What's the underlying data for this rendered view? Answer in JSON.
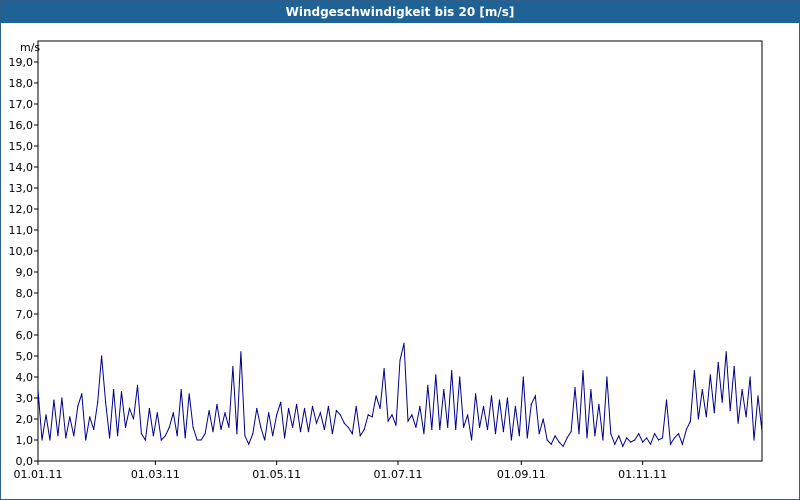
{
  "window": {
    "title": "Windgeschwindigkeit bis 20 [m/s]"
  },
  "chart_data": {
    "type": "line",
    "title": "Windgeschwindigkeit bis 20 [m/s]",
    "ylabel": "m/s",
    "xlabel": "",
    "ylim": [
      0,
      20
    ],
    "xlim": [
      "2011-01-01",
      "2011-12-31"
    ],
    "y_ticks": [
      "0,0",
      "1,0",
      "2,0",
      "3,0",
      "4,0",
      "5,0",
      "6,0",
      "7,0",
      "8,0",
      "9,0",
      "10,0",
      "11,0",
      "12,0",
      "13,0",
      "14,0",
      "15,0",
      "16,0",
      "17,0",
      "18,0",
      "19,0"
    ],
    "x_ticks": [
      {
        "label": "01.01.11",
        "date": "2011-01-01"
      },
      {
        "label": "01.03.11",
        "date": "2011-03-01"
      },
      {
        "label": "01.05.11",
        "date": "2011-05-01"
      },
      {
        "label": "01.07.11",
        "date": "2011-07-01"
      },
      {
        "label": "01.09.11",
        "date": "2011-09-01"
      },
      {
        "label": "01.11.11",
        "date": "2011-11-01"
      }
    ],
    "grid": true,
    "series_color": "#00008b",
    "series": [
      {
        "x": [
          "2011-01-01",
          "2011-01-03",
          "2011-01-05",
          "2011-01-07",
          "2011-01-09",
          "2011-01-11",
          "2011-01-13",
          "2011-01-15",
          "2011-01-17",
          "2011-01-19",
          "2011-01-21",
          "2011-01-23",
          "2011-01-25",
          "2011-01-27",
          "2011-01-29",
          "2011-01-31",
          "2011-02-02",
          "2011-02-04",
          "2011-02-06",
          "2011-02-08",
          "2011-02-10",
          "2011-02-12",
          "2011-02-14",
          "2011-02-16",
          "2011-02-18",
          "2011-02-20",
          "2011-02-22",
          "2011-02-24",
          "2011-02-26",
          "2011-02-28",
          "2011-03-02",
          "2011-03-04",
          "2011-03-06",
          "2011-03-08",
          "2011-03-10",
          "2011-03-12",
          "2011-03-14",
          "2011-03-16",
          "2011-03-18",
          "2011-03-20",
          "2011-03-22",
          "2011-03-24",
          "2011-03-26",
          "2011-03-28",
          "2011-03-30",
          "2011-04-01",
          "2011-04-03",
          "2011-04-05",
          "2011-04-07",
          "2011-04-09",
          "2011-04-11",
          "2011-04-13",
          "2011-04-15",
          "2011-04-17",
          "2011-04-19",
          "2011-04-21",
          "2011-04-23",
          "2011-04-25",
          "2011-04-27",
          "2011-04-29",
          "2011-05-01",
          "2011-05-03",
          "2011-05-05",
          "2011-05-07",
          "2011-05-09",
          "2011-05-11",
          "2011-05-13",
          "2011-05-15",
          "2011-05-17",
          "2011-05-19",
          "2011-05-21",
          "2011-05-23",
          "2011-05-25",
          "2011-05-27",
          "2011-05-29",
          "2011-05-31",
          "2011-06-02",
          "2011-06-04",
          "2011-06-06",
          "2011-06-08",
          "2011-06-10",
          "2011-06-12",
          "2011-06-14",
          "2011-06-16",
          "2011-06-18",
          "2011-06-20",
          "2011-06-22",
          "2011-06-24",
          "2011-06-26",
          "2011-06-28",
          "2011-06-30",
          "2011-07-02",
          "2011-07-04",
          "2011-07-06",
          "2011-07-08",
          "2011-07-10",
          "2011-07-12",
          "2011-07-14",
          "2011-07-16",
          "2011-07-18",
          "2011-07-20",
          "2011-07-22",
          "2011-07-24",
          "2011-07-26",
          "2011-07-28",
          "2011-07-30",
          "2011-08-01",
          "2011-08-03",
          "2011-08-05",
          "2011-08-07",
          "2011-08-09",
          "2011-08-11",
          "2011-08-13",
          "2011-08-15",
          "2011-08-17",
          "2011-08-19",
          "2011-08-21",
          "2011-08-23",
          "2011-08-25",
          "2011-08-27",
          "2011-08-29",
          "2011-08-31",
          "2011-09-02",
          "2011-09-04",
          "2011-09-06",
          "2011-09-08",
          "2011-09-10",
          "2011-09-12",
          "2011-09-14",
          "2011-09-16",
          "2011-09-18",
          "2011-09-20",
          "2011-09-22",
          "2011-09-24",
          "2011-09-26",
          "2011-09-28",
          "2011-09-30",
          "2011-10-02",
          "2011-10-04",
          "2011-10-06",
          "2011-10-08",
          "2011-10-10",
          "2011-10-12",
          "2011-10-14",
          "2011-10-16",
          "2011-10-18",
          "2011-10-20",
          "2011-10-22",
          "2011-10-24",
          "2011-10-26",
          "2011-10-28",
          "2011-10-30",
          "2011-11-01",
          "2011-11-03",
          "2011-11-05",
          "2011-11-07",
          "2011-11-09",
          "2011-11-11",
          "2011-11-13",
          "2011-11-15",
          "2011-11-17",
          "2011-11-19",
          "2011-11-21",
          "2011-11-23",
          "2011-11-25",
          "2011-11-27",
          "2011-11-29",
          "2011-12-01",
          "2011-12-03",
          "2011-12-05",
          "2011-12-07",
          "2011-12-09",
          "2011-12-11",
          "2011-12-13",
          "2011-12-15",
          "2011-12-17",
          "2011-12-19",
          "2011-12-21",
          "2011-12-23",
          "2011-12-25",
          "2011-12-27",
          "2011-12-29",
          "2011-12-31"
        ],
        "y": [
          3.4,
          1.0,
          2.2,
          1.0,
          2.9,
          1.2,
          3.0,
          1.1,
          2.1,
          1.2,
          2.6,
          3.2,
          1.0,
          2.1,
          1.5,
          2.8,
          5.0,
          2.8,
          1.1,
          3.4,
          1.2,
          3.3,
          1.6,
          2.5,
          2.0,
          3.6,
          1.3,
          1.0,
          2.5,
          1.2,
          2.3,
          1.0,
          1.2,
          1.6,
          2.3,
          1.2,
          3.4,
          1.1,
          3.2,
          1.6,
          1.0,
          1.0,
          1.3,
          2.4,
          1.4,
          2.7,
          1.5,
          2.3,
          1.6,
          4.5,
          1.3,
          5.2,
          1.2,
          0.8,
          1.3,
          2.5,
          1.6,
          1.0,
          2.3,
          1.2,
          2.2,
          2.8,
          1.1,
          2.5,
          1.6,
          2.7,
          1.4,
          2.5,
          1.4,
          2.6,
          1.8,
          2.3,
          1.5,
          2.6,
          1.3,
          2.4,
          2.2,
          1.8,
          1.6,
          1.3,
          2.6,
          1.2,
          1.5,
          2.2,
          2.1,
          3.1,
          2.5,
          4.4,
          1.9,
          2.2,
          1.7,
          4.8,
          5.6,
          1.9,
          2.2,
          1.6,
          2.6,
          1.3,
          3.6,
          1.5,
          4.1,
          1.5,
          3.4,
          1.6,
          4.3,
          1.5,
          4.0,
          1.6,
          2.2,
          1.0,
          3.2,
          1.6,
          2.6,
          1.5,
          3.1,
          1.3,
          2.9,
          1.4,
          3.0,
          1.0,
          2.6,
          1.2,
          4.0,
          1.1,
          2.7,
          3.1,
          1.3,
          2.0,
          1.0,
          0.8,
          1.2,
          0.9,
          0.7,
          1.1,
          1.4,
          3.5,
          1.3,
          4.3,
          1.1,
          3.4,
          1.2,
          2.7,
          1.0,
          4.0,
          1.3,
          0.8,
          1.2,
          0.7,
          1.1,
          0.9,
          1.0,
          1.3,
          0.9,
          1.1,
          0.8,
          1.3,
          1.0,
          1.1,
          2.9,
          0.8,
          1.1,
          1.3,
          0.8,
          1.5,
          1.9,
          4.3,
          2.0,
          3.4,
          2.1,
          4.1,
          2.3,
          4.7,
          2.8,
          5.2,
          2.4,
          4.5,
          1.8,
          3.4,
          2.1,
          4.0,
          1.0,
          3.1,
          1.4
        ]
      }
    ]
  }
}
